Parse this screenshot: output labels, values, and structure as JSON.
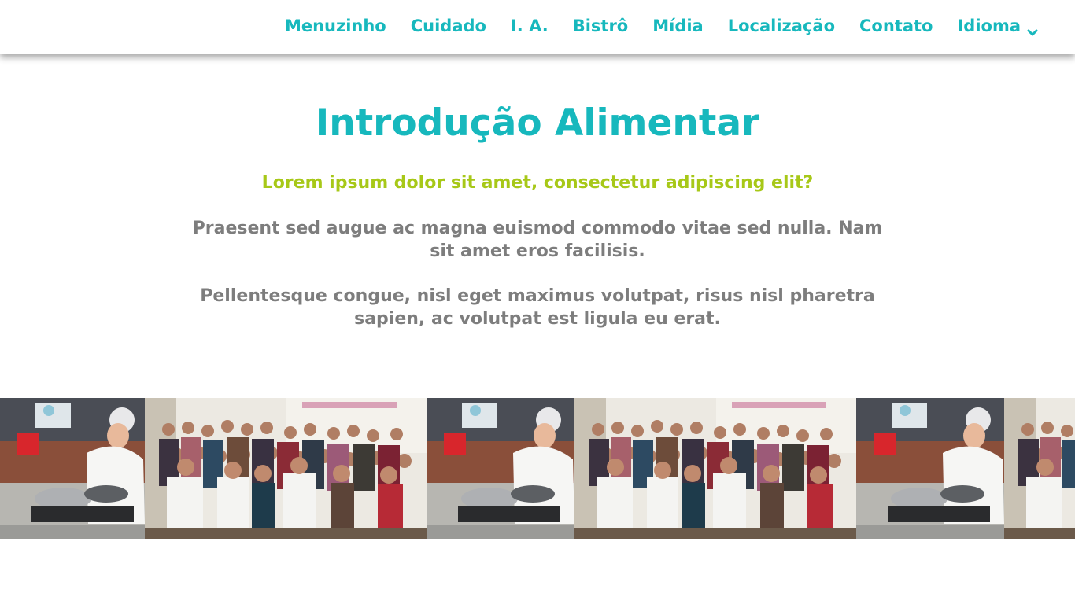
{
  "nav": {
    "items": [
      "Menuzinho",
      "Cuidado",
      "I. A.",
      "Bistrô",
      "Mídia",
      "Localização",
      "Contato"
    ],
    "language_label": "Idioma"
  },
  "main": {
    "title": "Introdução Alimentar",
    "subtitle": "Lorem ipsum dolor sit amet, consectetur adipiscing elit?",
    "paragraph_1": "Praesent sed augue ac magna euismod commodo vitae sed nulla. Nam sit amet eros facilisis.",
    "paragraph_2": "Pellentesque congue, nisl eget maximus volutpat, risus nisl pharetra sapien, ac volutpat est ligula eu erat."
  },
  "colors": {
    "accent_teal": "#17b8bd",
    "accent_lime": "#a7c818",
    "body_gray": "#7d7d7d"
  }
}
